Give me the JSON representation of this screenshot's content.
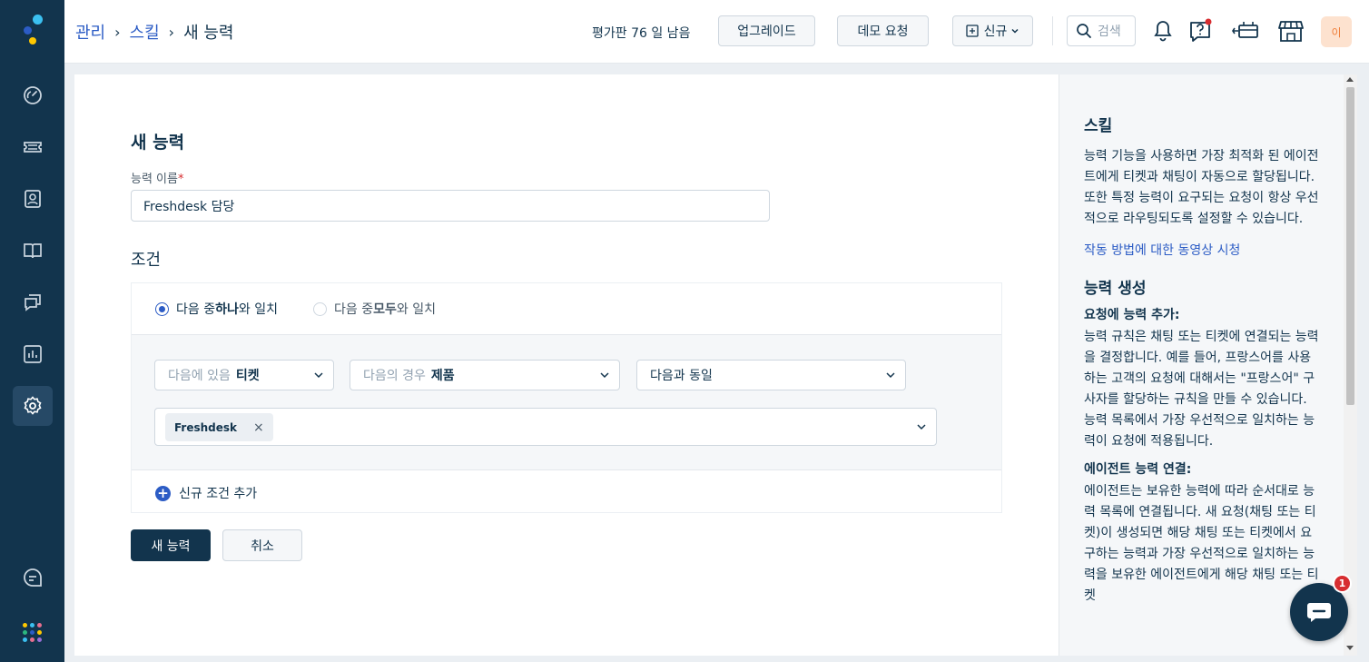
{
  "sidebar": {
    "items": [
      {
        "name": "dashboard",
        "icon": "gauge-icon"
      },
      {
        "name": "tickets",
        "icon": "ticket-icon"
      },
      {
        "name": "contacts",
        "icon": "contact-card-icon"
      },
      {
        "name": "solutions",
        "icon": "book-icon"
      },
      {
        "name": "conversations",
        "icon": "chat-bubbles-icon"
      },
      {
        "name": "reports",
        "icon": "bar-chart-icon"
      },
      {
        "name": "admin",
        "icon": "gear-icon",
        "active": true
      },
      {
        "name": "freddy",
        "icon": "freddy-chat-icon"
      }
    ],
    "apps_icon": "apps-grid-icon"
  },
  "header": {
    "breadcrumb": [
      "관리",
      "스킬",
      "새 능력"
    ],
    "trial_text": "평가판 76 일 남음",
    "upgrade_label": "업그레이드",
    "demo_label": "데모 요청",
    "new_label": "신규",
    "search_placeholder": "검색",
    "avatar_initial": "이"
  },
  "form": {
    "title": "새 능력",
    "name_label": "능력 이름",
    "required_mark": "*",
    "name_value": "Freshdesk 담당",
    "conditions_title": "조건",
    "match_any_prefix": "다음 중 ",
    "match_any_bold": "하나",
    "match_any_suffix": "와 일치",
    "match_all_prefix": "다음 중 ",
    "match_all_bold": "모두",
    "match_all_suffix": "와 일치",
    "select1_prefix": "다음에 있음",
    "select1_value": "티켓",
    "select2_prefix": "다음의 경우",
    "select2_value": "제품",
    "select3_value": "다음과 동일",
    "tag_value": "Freshdesk",
    "tag_remove": "×",
    "add_condition": "신규 조건 추가",
    "submit_label": "새 능력",
    "cancel_label": "취소"
  },
  "help": {
    "title": "스킬",
    "intro": "능력 기능을 사용하면 가장 최적화 된 에이전트에게 티켓과 채팅이 자동으로 할당됩니다. 또한 특정 능력이 요구되는 요청이 항상 우선적으로 라우팅되도록 설정할 수 있습니다.",
    "video_link": "작동 방법에 대한 동영상 시청",
    "create_title": "능력 생성",
    "add_subtitle": "요청에 능력 추가:",
    "add_text": "능력 규칙은 채팅 또는 티켓에 연결되는 능력을 결정합니다. 예를 들어, 프랑스어를 사용하는 고객의 요청에 대해서는 \"프랑스어\" 구사자를 할당하는 규칙을 만들 수 있습니다. 능력 목록에서 가장 우선적으로 일치하는 능력이 요청에 적용됩니다.",
    "link_subtitle": "에이전트 능력 연결:",
    "link_text": "에이전트는 보유한 능력에 따라 순서대로 능력 목록에 연결됩니다. 새 요청(채팅 또는 티켓)이 생성되면 해당 채팅 또는 티켓에서 요구하는 능력과 가장 우선적으로 일치하는 능력을 보유한 에이전트에게 해당 채팅 또는 티켓"
  },
  "chat_widget": {
    "badge_count": "1"
  },
  "colors": {
    "sidebar_bg": "#12344d",
    "accent": "#2c5cc5",
    "danger": "#d72d30"
  }
}
